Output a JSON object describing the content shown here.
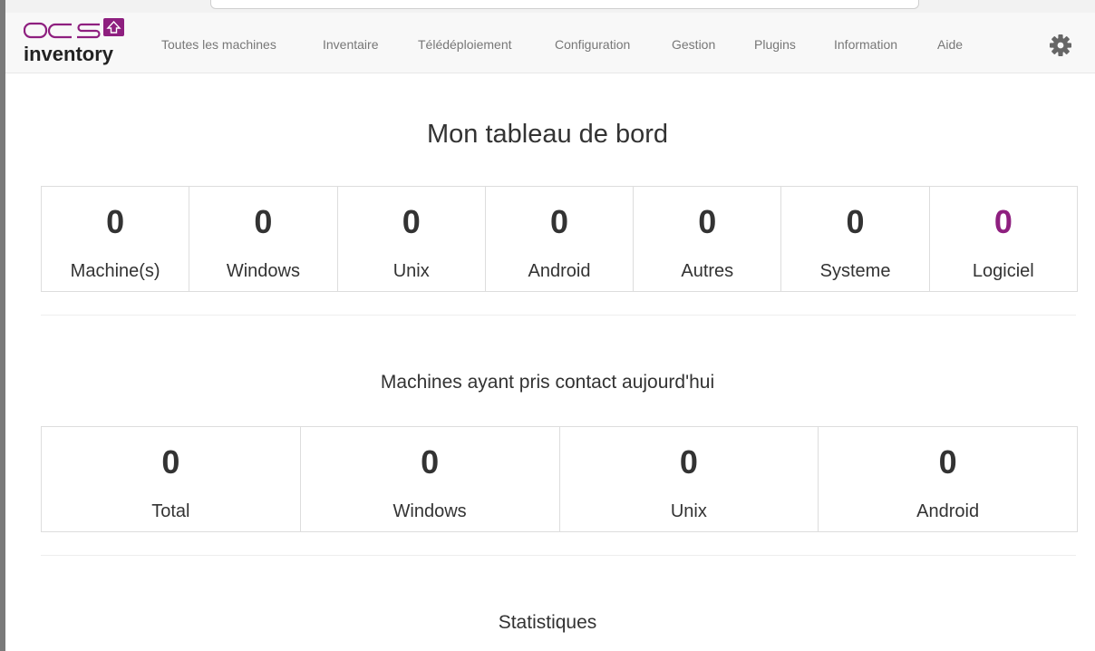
{
  "logo": {
    "top_text": "OCS",
    "bottom_text": "inventory"
  },
  "nav": {
    "items": [
      "Toutes les machines",
      "Inventaire",
      "Télédéploiement",
      "Configuration",
      "Gestion",
      "Plugins",
      "Information",
      "Aide"
    ],
    "settings_icon": "gear-icon"
  },
  "page": {
    "title": "Mon tableau de bord"
  },
  "summary": [
    {
      "value": "0",
      "label": "Machine(s)"
    },
    {
      "value": "0",
      "label": "Windows"
    },
    {
      "value": "0",
      "label": "Unix"
    },
    {
      "value": "0",
      "label": "Android"
    },
    {
      "value": "0",
      "label": "Autres"
    },
    {
      "value": "0",
      "label": "Systeme"
    },
    {
      "value": "0",
      "label": "Logiciel"
    }
  ],
  "contact": {
    "title": "Machines ayant pris contact aujourd'hui",
    "stats": [
      {
        "value": "0",
        "label": "Total"
      },
      {
        "value": "0",
        "label": "Windows"
      },
      {
        "value": "0",
        "label": "Unix"
      },
      {
        "value": "0",
        "label": "Android"
      }
    ]
  },
  "statistics": {
    "title": "Statistiques"
  },
  "colors": {
    "accent": "#8e1f7f",
    "text": "#333333",
    "nav_text": "#777777"
  }
}
